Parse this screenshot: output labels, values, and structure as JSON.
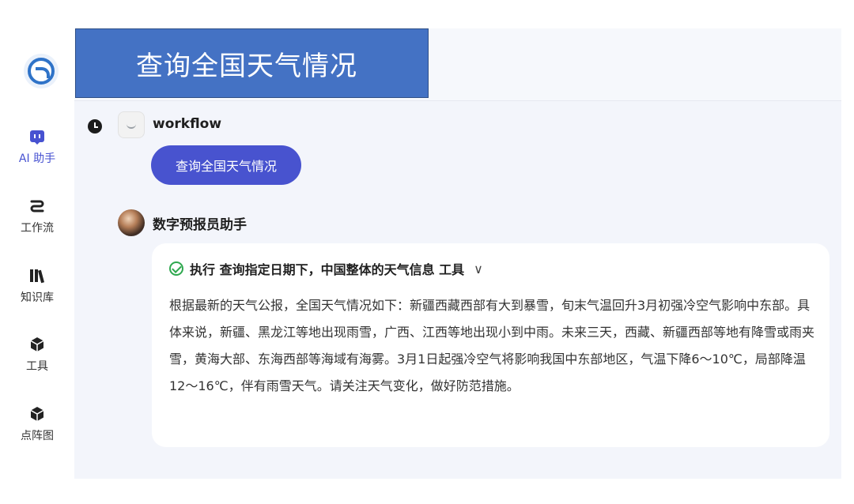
{
  "sidebar": {
    "items": [
      {
        "label": "AI 助手",
        "icon": "robot-chat-icon"
      },
      {
        "label": "工作流",
        "icon": "workflow-icon"
      },
      {
        "label": "知识库",
        "icon": "books-icon"
      },
      {
        "label": "工具",
        "icon": "cube-icon"
      },
      {
        "label": "点阵图",
        "icon": "cube-icon"
      }
    ]
  },
  "banner": {
    "title": "查询全国天气情况"
  },
  "conversation": {
    "user_name": "workflow",
    "user_message": "查询全国天气情况",
    "bot_name": "数字预报员助手",
    "tool_call": "执行 查询指定日期下，中国整体的天气信息 工具",
    "answer": "根据最新的天气公报，全国天气情况如下：新疆西藏西部有大到暴雪，旬末气温回升3月初强冷空气影响中东部。具体来说，新疆、黑龙江等地出现雨雪，广西、江西等地出现小到中雨。未来三天，西藏、新疆西部等地有降雪或雨夹雪，黄海大部、东海西部等海域有海雾。3月1日起强冷空气将影响我国中东部地区，气温下降6～10℃，局部降温12～16℃，伴有雨雪天气。请关注天气变化，做好防范措施。"
  },
  "colors": {
    "accent": "#4853cf",
    "banner": "#4472c4",
    "success": "#2fa84f"
  }
}
